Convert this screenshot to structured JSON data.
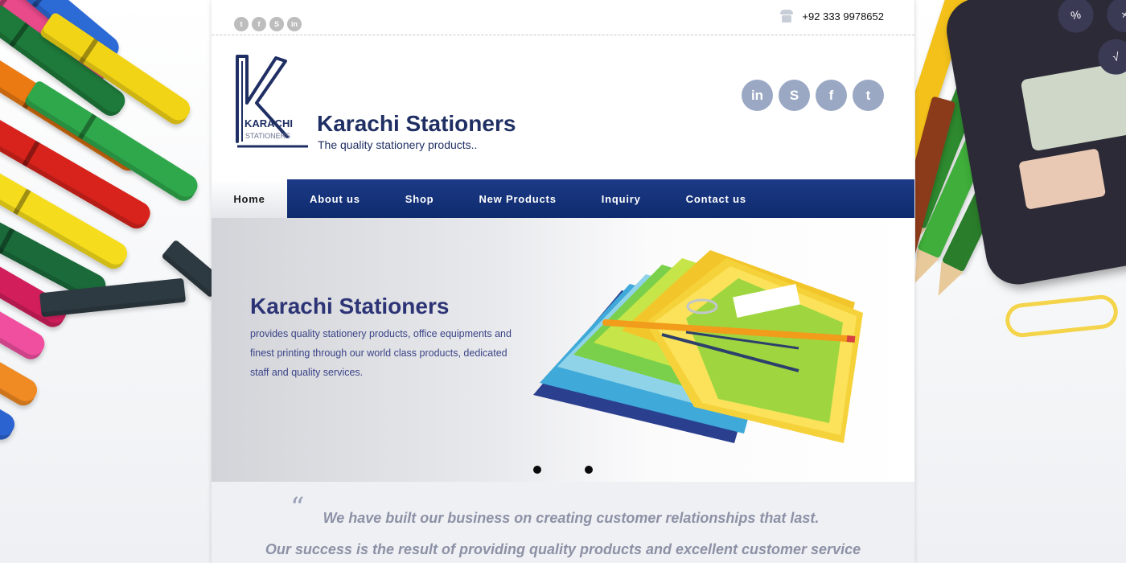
{
  "topbar": {
    "mini_social": [
      {
        "icon": "twitter-icon",
        "glyph": "t"
      },
      {
        "icon": "facebook-icon",
        "glyph": "f"
      },
      {
        "icon": "skype-icon",
        "glyph": "S"
      },
      {
        "icon": "linkedin-icon",
        "glyph": "in"
      }
    ],
    "phone_icon": "phone-icon",
    "phone": "+92 333 9978652"
  },
  "header": {
    "logo_word": "KARACHI",
    "logo_sub": "STATIONERS",
    "brand_name": "Karachi Stationers",
    "tagline": "The quality stationery products..",
    "social": [
      {
        "icon": "linkedin-icon",
        "glyph": "in"
      },
      {
        "icon": "skype-icon",
        "glyph": "S"
      },
      {
        "icon": "facebook-icon",
        "glyph": "f"
      },
      {
        "icon": "twitter-icon",
        "glyph": "t"
      }
    ]
  },
  "nav": {
    "items": [
      {
        "label": "Home",
        "active": true
      },
      {
        "label": "About us"
      },
      {
        "label": "Shop"
      },
      {
        "label": "New Products"
      },
      {
        "label": "Inquiry"
      },
      {
        "label": "Contact us"
      }
    ]
  },
  "hero": {
    "title": "Karachi Stationers",
    "text": "provides quality stationery products, office equipments and finest printing through our world class products, dedicated staff and quality services.",
    "slides": [
      {
        "active": true
      },
      {
        "active": false
      },
      {
        "active": true
      }
    ]
  },
  "quote": {
    "mark": "“",
    "line1": "We have built our business on creating customer relationships that last.",
    "line2": "Our success is the result of providing quality products and excellent customer service"
  },
  "colors": {
    "brand_navy": "#1f2f63",
    "nav_blue": "#1c3a86",
    "social_blue": "#9aa8c4",
    "quote_gray": "#8c91a5"
  }
}
